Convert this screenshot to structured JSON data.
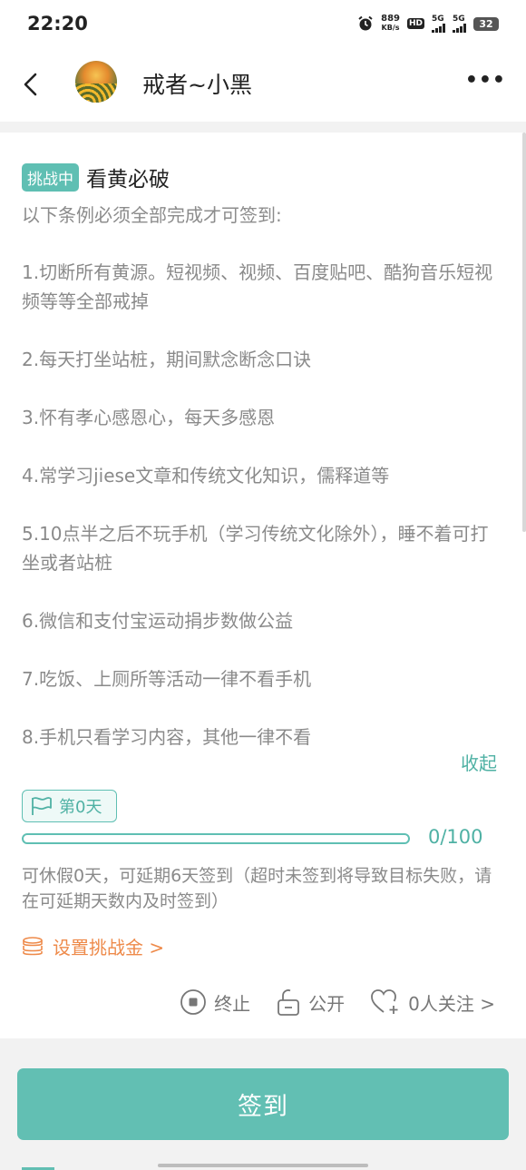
{
  "status_bar": {
    "time": "22:20",
    "net_speed_value": "889",
    "net_speed_unit": "KB/s",
    "hd": "HD",
    "sim1": "5G",
    "sim2": "5G",
    "battery": "32"
  },
  "header": {
    "title": "戒者~小黑"
  },
  "challenge": {
    "badge": "挑战中",
    "title": "看黄必破",
    "intro": "以下条例必须全部完成才可签到:",
    "rules": [
      "1.切断所有黄源。短视频、视频、百度贴吧、酷狗音乐短视频等等全部戒掉",
      "2.每天打坐站桩，期间默念断念口诀",
      "3.怀有孝心感恩心，每天多感恩",
      "4.常学习jiese文章和传统文化知识，儒释道等",
      "5.10点半之后不玩手机（学习传统文化除外），睡不着可打坐或者站桩",
      "6.微信和支付宝运动捐步数做公益",
      "7.吃饭、上厕所等活动一律不看手机",
      "8.手机只看学习内容，其他一律不看"
    ],
    "collapse_label": "收起",
    "day_label": "第0天",
    "progress_text": "0/100",
    "progress_fraction": 0,
    "notice": "可休假0天，可延期6天签到（超时未签到将导致目标失败，请在可延期天数内及时签到）",
    "set_fund_label": "设置挑战金 >",
    "actions": {
      "stop": "终止",
      "public": "公开",
      "followers": "0人关注 >"
    }
  },
  "checkin_button": "签到",
  "colors": {
    "accent": "#5fbfb3",
    "orange": "#ee8a4a"
  }
}
